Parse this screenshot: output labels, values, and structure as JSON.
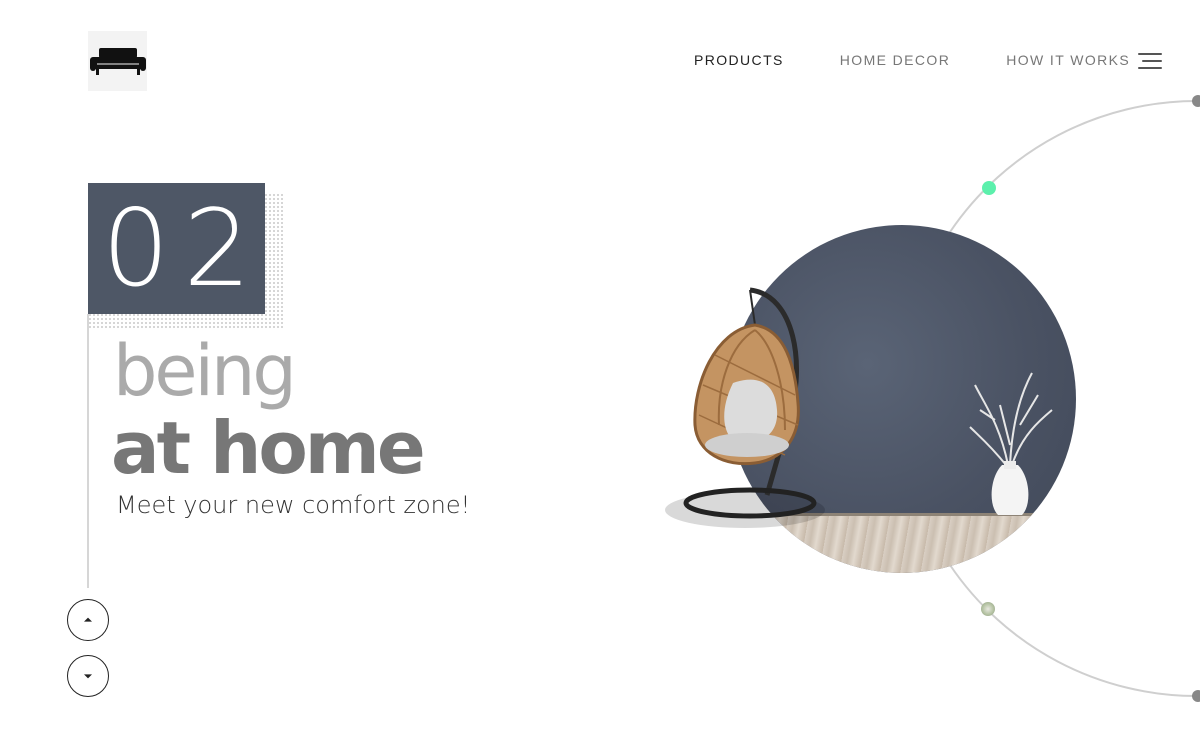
{
  "header": {
    "logo_icon": "sofa-icon",
    "nav": {
      "products": "PRODUCTS",
      "home_decor": "HOME DECOR",
      "how_it_works": "HOW IT WORKS"
    },
    "menu_icon": "hamburger-menu-icon"
  },
  "hero": {
    "slide_number": "02",
    "headline_light": "being",
    "headline_bold": "at home",
    "tagline": "Meet your new comfort zone!"
  },
  "slider_controls": {
    "up_icon": "caret-up-icon",
    "down_icon": "caret-down-icon"
  },
  "colors": {
    "accent_green": "#5cf0ac",
    "slate": "#4e5766",
    "text_dark": "#333333",
    "text_muted": "#777777",
    "text_light": "#aaaaaa"
  }
}
